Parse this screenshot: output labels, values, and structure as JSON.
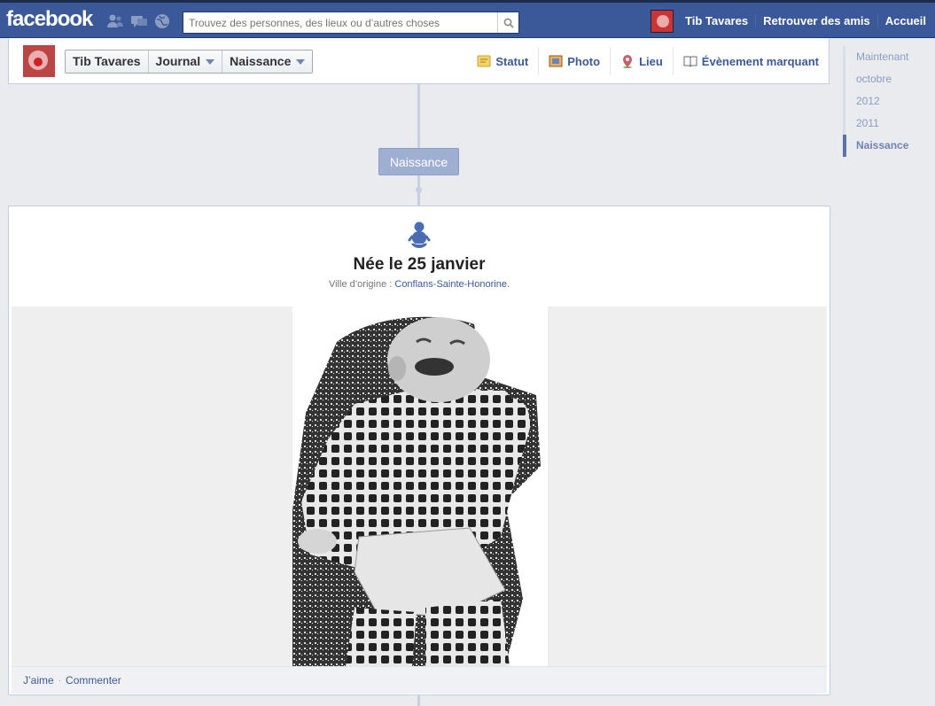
{
  "topbar": {
    "logo": "facebook",
    "jewels": [
      "friend-requests-icon",
      "messages-icon",
      "notifications-icon"
    ],
    "search_placeholder": "Trouvez des personnes, des lieux ou d’autres choses",
    "user_name": "Tib Tavares",
    "links": [
      "Retrouver des amis",
      "Accueil"
    ]
  },
  "timeline_header": {
    "breadcrumbs": [
      "Tib Tavares",
      "Journal",
      "Naissance"
    ],
    "composer": [
      {
        "label": "Statut",
        "icon": "status-icon"
      },
      {
        "label": "Photo",
        "icon": "photo-icon"
      },
      {
        "label": "Lieu",
        "icon": "place-pin-icon"
      },
      {
        "label": "Évènement marquant",
        "icon": "life-event-book-icon"
      }
    ]
  },
  "scrubber": {
    "items": [
      "Maintenant",
      "octobre",
      "2012",
      "2011",
      "Naissance"
    ],
    "active": "Naissance"
  },
  "section_label": "Naissance",
  "event": {
    "icon": "baby-icon",
    "title": "Née le 25 janvier",
    "hometown_prefix": "Ville d’origine : ",
    "hometown": "Conflans-Sainte-Honorine."
  },
  "footer": {
    "like": "J’aime",
    "separator": "·",
    "comment": "Commenter"
  },
  "colors": {
    "brand_blue": "#3b5998",
    "link_blue": "#3b5998",
    "section_pill": "#9eafd2"
  }
}
